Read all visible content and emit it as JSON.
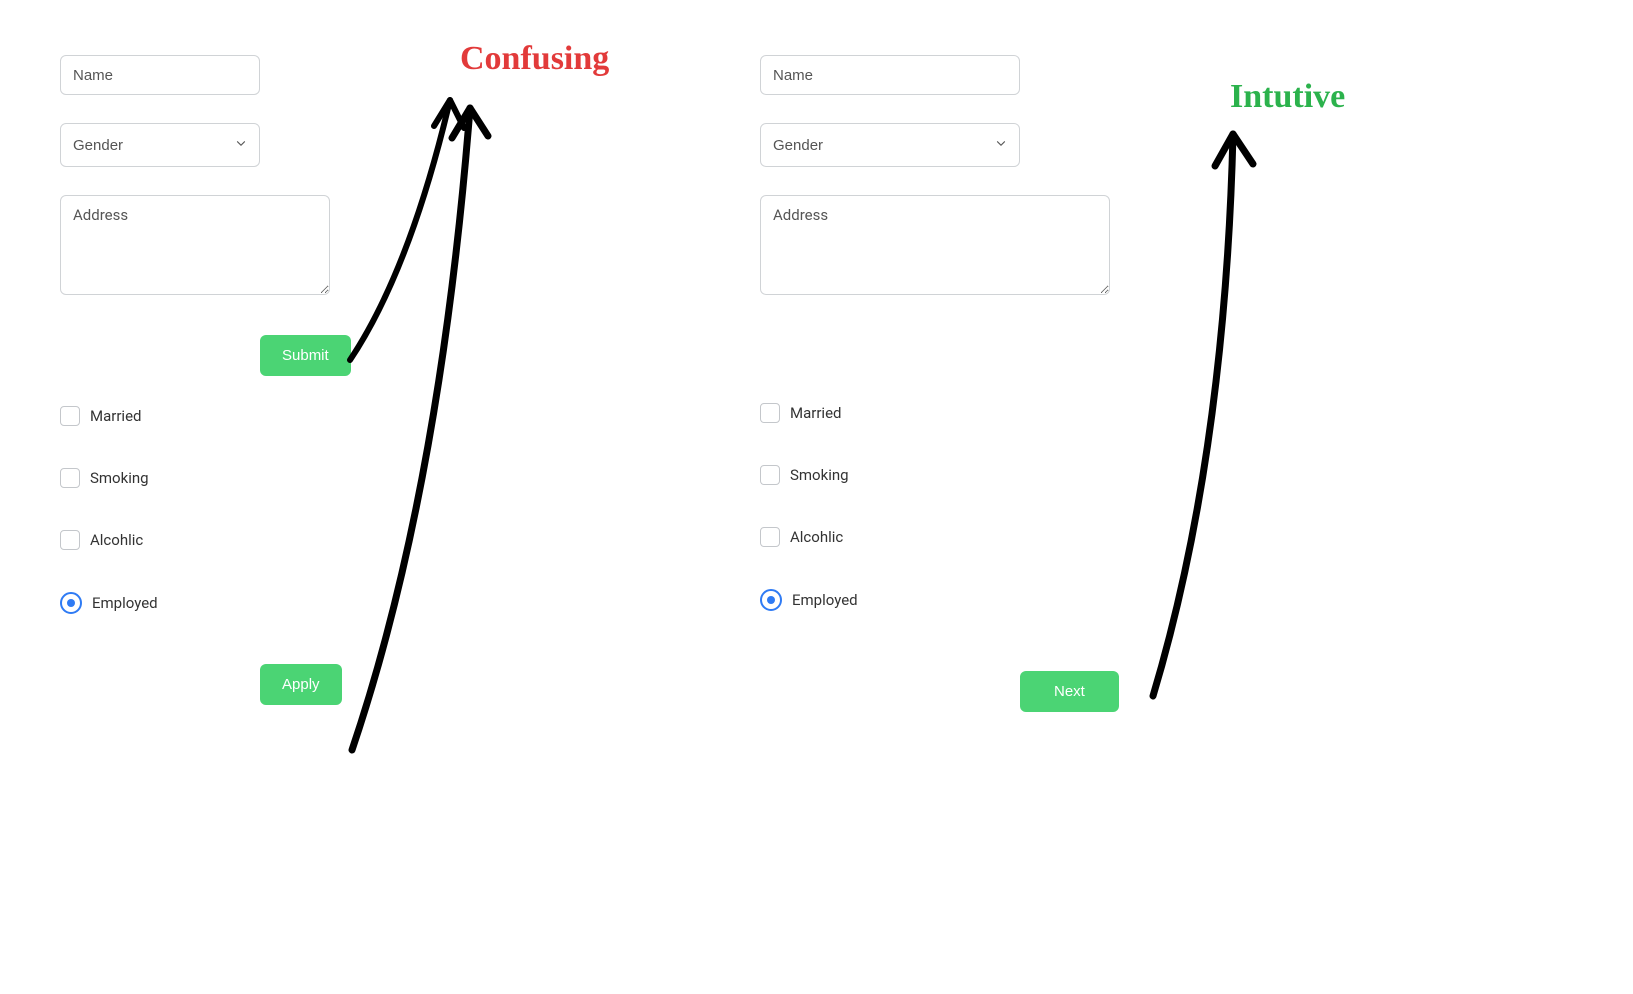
{
  "annotations": {
    "confusing": "Confusing",
    "intuitive": "Intutive"
  },
  "colors": {
    "button_bg": "#4bd474",
    "annot_red": "#e23a3a",
    "annot_green": "#2bb24c",
    "radio_blue": "#2f7bf4"
  },
  "left_form": {
    "name_placeholder": "Name",
    "gender_placeholder": "Gender",
    "address_placeholder": "Address",
    "submit_label": "Submit",
    "apply_label": "Apply",
    "checks": {
      "married": "Married",
      "smoking": "Smoking",
      "alcoholic": "Alcohlic",
      "employed": "Employed"
    }
  },
  "right_form": {
    "name_placeholder": "Name",
    "gender_placeholder": "Gender",
    "address_placeholder": "Address",
    "next_label": "Next",
    "checks": {
      "married": "Married",
      "smoking": "Smoking",
      "alcoholic": "Alcohlic",
      "employed": "Employed"
    }
  }
}
